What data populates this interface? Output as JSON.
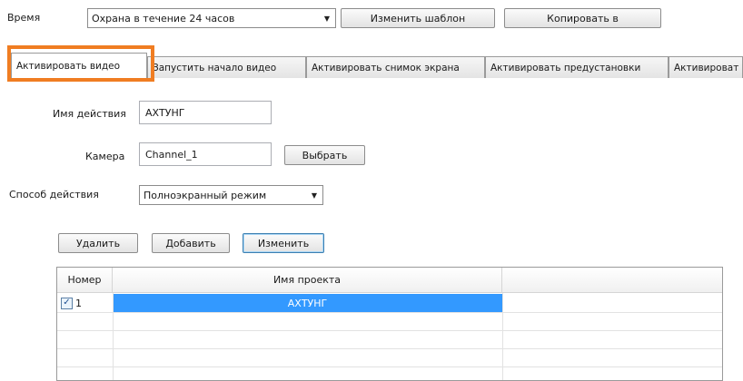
{
  "time": {
    "label": "Время",
    "schedule_value": "Охрана в течение 24 часов",
    "change_template_label": "Изменить шаблон",
    "copy_to_label": "Копировать в"
  },
  "tabs": [
    {
      "label": "Активировать видео",
      "active": true
    },
    {
      "label": "Запустить начало видео",
      "active": false
    },
    {
      "label": "Активировать снимок экрана",
      "active": false
    },
    {
      "label": "Активировать предустановки",
      "active": false
    },
    {
      "label": "Активироват",
      "active": false
    }
  ],
  "form": {
    "action_name_label": "Имя действия",
    "action_name_value": "АХТУНГ",
    "camera_label": "Камера",
    "camera_value": "Channel_1",
    "select_label": "Выбрать",
    "action_mode_label": "Способ действия",
    "action_mode_value": "Полноэкранный режим"
  },
  "toolbar": {
    "delete_label": "Удалить",
    "add_label": "Добавить",
    "edit_label": "Изменить"
  },
  "table": {
    "columns": [
      "Номер",
      "Имя проекта"
    ],
    "rows": [
      {
        "checked": true,
        "number": "1",
        "project_name": "АХТУНГ",
        "selected": true
      }
    ]
  },
  "colors": {
    "highlight_border": "#f07d22",
    "selection": "#3399ff"
  }
}
